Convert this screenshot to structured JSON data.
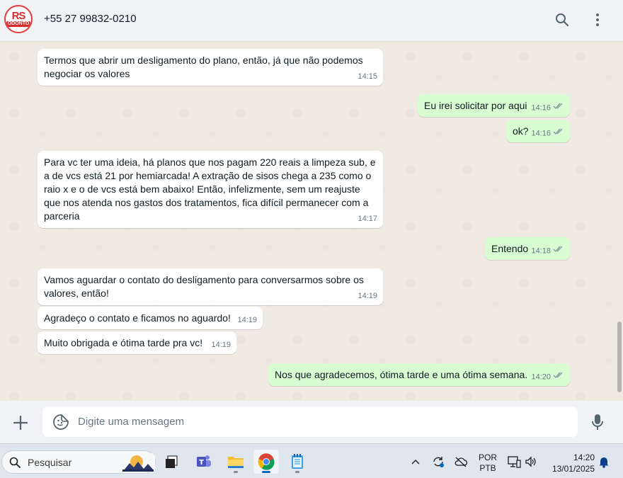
{
  "header": {
    "avatar_text_top": "RS",
    "avatar_text_bottom": "ODONTO",
    "contact_name": "+55 27 99832-0210",
    "icons": [
      "search-icon",
      "more-options-icon"
    ]
  },
  "messages": [
    {
      "dir": "in",
      "text": "Termos que abrir um desligamento do plano, então, já que não podemos negociar os valores",
      "time": "14:15"
    },
    {
      "dir": "out",
      "text": "Eu irei solicitar por aqui",
      "time": "14:16"
    },
    {
      "dir": "out",
      "text": "ok?",
      "time": "14:16"
    },
    {
      "dir": "in",
      "text": "Para vc ter uma ideia, há planos que nos pagam 220 reais a limpeza sub, e a de vcs está 21 por hemiarcada! A extração de sisos chega a 235 como o raio x e o de vcs está bem abaixo! Então, infelizmente, sem um reajuste que nos atenda nos gastos dos tratamentos, fica difícil permanecer com a parceria",
      "time": "14:17"
    },
    {
      "dir": "out",
      "text": "Entendo",
      "time": "14:18"
    },
    {
      "dir": "in",
      "text": "Vamos aguardar o contato do desligamento para conversarmos sobre os valores, então!",
      "time": "14:19"
    },
    {
      "dir": "in",
      "text": "Agradeço o contato e ficamos no aguardo!",
      "time": "14:19"
    },
    {
      "dir": "in",
      "text": "Muito obrigada e ótima tarde pra vc!",
      "time": "14:19"
    },
    {
      "dir": "out",
      "text": "Nos que agradecemos, ótima tarde e uma ótima semana.",
      "time": "14:20"
    }
  ],
  "compose": {
    "placeholder": "Digite uma mensagem",
    "value": ""
  },
  "taskbar": {
    "search_label": "Pesquisar",
    "lang_line1": "POR",
    "lang_line2": "PTB",
    "time": "14:20",
    "date": "13/01/2025"
  },
  "colors": {
    "incoming": "#ffffff",
    "outgoing": "#d9fdd3",
    "chat_bg": "#efeae2",
    "read_ticks": "#8696a0"
  }
}
